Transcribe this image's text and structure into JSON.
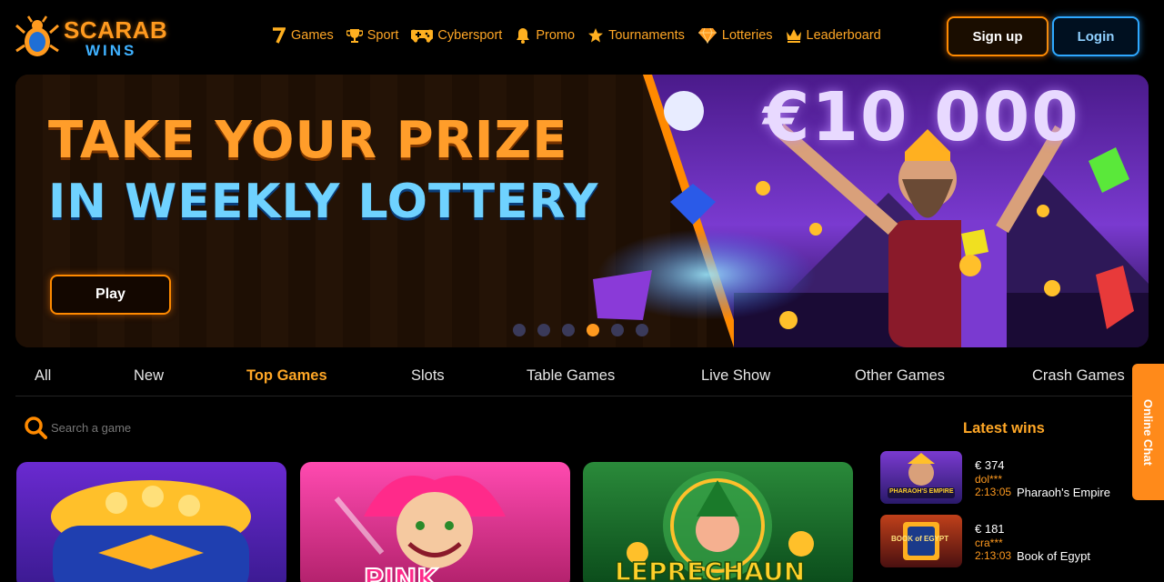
{
  "header": {
    "logo_top": "SCARAB",
    "logo_bottom": "WINS",
    "nav": [
      {
        "label": "Games",
        "icon": "seven-icon"
      },
      {
        "label": "Sport",
        "icon": "trophy-icon"
      },
      {
        "label": "Cybersport",
        "icon": "gamepad-icon"
      },
      {
        "label": "Promo",
        "icon": "bell-icon"
      },
      {
        "label": "Tournaments",
        "icon": "star-icon"
      },
      {
        "label": "Lotteries",
        "icon": "diamond-icon"
      },
      {
        "label": "Leaderboard",
        "icon": "crown-icon"
      }
    ],
    "signup_label": "Sign up",
    "login_label": "Login"
  },
  "banner": {
    "headline_line1": "TAKE YOUR PRIZE",
    "headline_line2": "IN WEEKLY LOTTERY",
    "prize": "€10 000",
    "play_label": "Play",
    "slide_count": 6,
    "active_slide": 4
  },
  "tabs": [
    {
      "label": "All",
      "active": false
    },
    {
      "label": "New",
      "active": false
    },
    {
      "label": "Top Games",
      "active": true
    },
    {
      "label": "Slots",
      "active": false
    },
    {
      "label": "Table Games",
      "active": false
    },
    {
      "label": "Live Show",
      "active": false
    },
    {
      "label": "Other Games",
      "active": false
    },
    {
      "label": "Crash Games",
      "active": false
    }
  ],
  "search": {
    "placeholder": "Search a game"
  },
  "games": [
    {
      "title": "",
      "theme": "gold-pot"
    },
    {
      "title": "PINK",
      "theme": "joker"
    },
    {
      "title": "LEPRECHAUN",
      "theme": "leprechaun"
    }
  ],
  "latest_wins": {
    "title": "Latest wins",
    "items": [
      {
        "amount": "€ 374",
        "user": "dol***",
        "time": "2:13:05",
        "game": "Pharaoh's Empire",
        "thumb_text": "PHARAOH'S EMPIRE"
      },
      {
        "amount": "€ 181",
        "user": "cra***",
        "time": "2:13:03",
        "game": "Book of Egypt",
        "thumb_text": "BOOK of EGYPT"
      }
    ]
  },
  "chat": {
    "label": "Online Chat"
  },
  "colors": {
    "accent_orange": "#ffa726",
    "accent_blue": "#2ea8ff",
    "background": "#000000"
  }
}
